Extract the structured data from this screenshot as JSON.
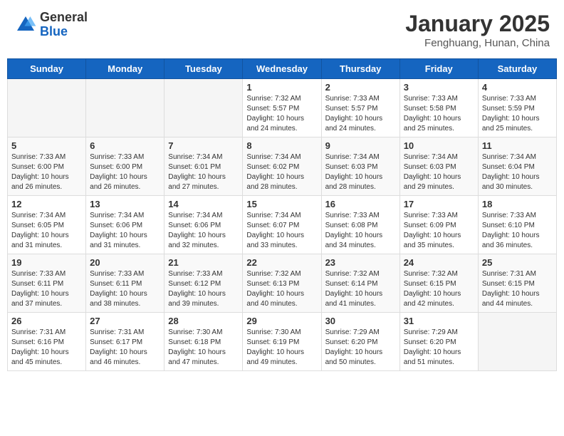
{
  "header": {
    "logo_general": "General",
    "logo_blue": "Blue",
    "month_title": "January 2025",
    "location": "Fenghuang, Hunan, China"
  },
  "weekdays": [
    "Sunday",
    "Monday",
    "Tuesday",
    "Wednesday",
    "Thursday",
    "Friday",
    "Saturday"
  ],
  "weeks": [
    [
      {
        "day": "",
        "info": ""
      },
      {
        "day": "",
        "info": ""
      },
      {
        "day": "",
        "info": ""
      },
      {
        "day": "1",
        "info": "Sunrise: 7:32 AM\nSunset: 5:57 PM\nDaylight: 10 hours\nand 24 minutes."
      },
      {
        "day": "2",
        "info": "Sunrise: 7:33 AM\nSunset: 5:57 PM\nDaylight: 10 hours\nand 24 minutes."
      },
      {
        "day": "3",
        "info": "Sunrise: 7:33 AM\nSunset: 5:58 PM\nDaylight: 10 hours\nand 25 minutes."
      },
      {
        "day": "4",
        "info": "Sunrise: 7:33 AM\nSunset: 5:59 PM\nDaylight: 10 hours\nand 25 minutes."
      }
    ],
    [
      {
        "day": "5",
        "info": "Sunrise: 7:33 AM\nSunset: 6:00 PM\nDaylight: 10 hours\nand 26 minutes."
      },
      {
        "day": "6",
        "info": "Sunrise: 7:33 AM\nSunset: 6:00 PM\nDaylight: 10 hours\nand 26 minutes."
      },
      {
        "day": "7",
        "info": "Sunrise: 7:34 AM\nSunset: 6:01 PM\nDaylight: 10 hours\nand 27 minutes."
      },
      {
        "day": "8",
        "info": "Sunrise: 7:34 AM\nSunset: 6:02 PM\nDaylight: 10 hours\nand 28 minutes."
      },
      {
        "day": "9",
        "info": "Sunrise: 7:34 AM\nSunset: 6:03 PM\nDaylight: 10 hours\nand 28 minutes."
      },
      {
        "day": "10",
        "info": "Sunrise: 7:34 AM\nSunset: 6:03 PM\nDaylight: 10 hours\nand 29 minutes."
      },
      {
        "day": "11",
        "info": "Sunrise: 7:34 AM\nSunset: 6:04 PM\nDaylight: 10 hours\nand 30 minutes."
      }
    ],
    [
      {
        "day": "12",
        "info": "Sunrise: 7:34 AM\nSunset: 6:05 PM\nDaylight: 10 hours\nand 31 minutes."
      },
      {
        "day": "13",
        "info": "Sunrise: 7:34 AM\nSunset: 6:06 PM\nDaylight: 10 hours\nand 31 minutes."
      },
      {
        "day": "14",
        "info": "Sunrise: 7:34 AM\nSunset: 6:06 PM\nDaylight: 10 hours\nand 32 minutes."
      },
      {
        "day": "15",
        "info": "Sunrise: 7:34 AM\nSunset: 6:07 PM\nDaylight: 10 hours\nand 33 minutes."
      },
      {
        "day": "16",
        "info": "Sunrise: 7:33 AM\nSunset: 6:08 PM\nDaylight: 10 hours\nand 34 minutes."
      },
      {
        "day": "17",
        "info": "Sunrise: 7:33 AM\nSunset: 6:09 PM\nDaylight: 10 hours\nand 35 minutes."
      },
      {
        "day": "18",
        "info": "Sunrise: 7:33 AM\nSunset: 6:10 PM\nDaylight: 10 hours\nand 36 minutes."
      }
    ],
    [
      {
        "day": "19",
        "info": "Sunrise: 7:33 AM\nSunset: 6:11 PM\nDaylight: 10 hours\nand 37 minutes."
      },
      {
        "day": "20",
        "info": "Sunrise: 7:33 AM\nSunset: 6:11 PM\nDaylight: 10 hours\nand 38 minutes."
      },
      {
        "day": "21",
        "info": "Sunrise: 7:33 AM\nSunset: 6:12 PM\nDaylight: 10 hours\nand 39 minutes."
      },
      {
        "day": "22",
        "info": "Sunrise: 7:32 AM\nSunset: 6:13 PM\nDaylight: 10 hours\nand 40 minutes."
      },
      {
        "day": "23",
        "info": "Sunrise: 7:32 AM\nSunset: 6:14 PM\nDaylight: 10 hours\nand 41 minutes."
      },
      {
        "day": "24",
        "info": "Sunrise: 7:32 AM\nSunset: 6:15 PM\nDaylight: 10 hours\nand 42 minutes."
      },
      {
        "day": "25",
        "info": "Sunrise: 7:31 AM\nSunset: 6:15 PM\nDaylight: 10 hours\nand 44 minutes."
      }
    ],
    [
      {
        "day": "26",
        "info": "Sunrise: 7:31 AM\nSunset: 6:16 PM\nDaylight: 10 hours\nand 45 minutes."
      },
      {
        "day": "27",
        "info": "Sunrise: 7:31 AM\nSunset: 6:17 PM\nDaylight: 10 hours\nand 46 minutes."
      },
      {
        "day": "28",
        "info": "Sunrise: 7:30 AM\nSunset: 6:18 PM\nDaylight: 10 hours\nand 47 minutes."
      },
      {
        "day": "29",
        "info": "Sunrise: 7:30 AM\nSunset: 6:19 PM\nDaylight: 10 hours\nand 49 minutes."
      },
      {
        "day": "30",
        "info": "Sunrise: 7:29 AM\nSunset: 6:20 PM\nDaylight: 10 hours\nand 50 minutes."
      },
      {
        "day": "31",
        "info": "Sunrise: 7:29 AM\nSunset: 6:20 PM\nDaylight: 10 hours\nand 51 minutes."
      },
      {
        "day": "",
        "info": ""
      }
    ]
  ]
}
